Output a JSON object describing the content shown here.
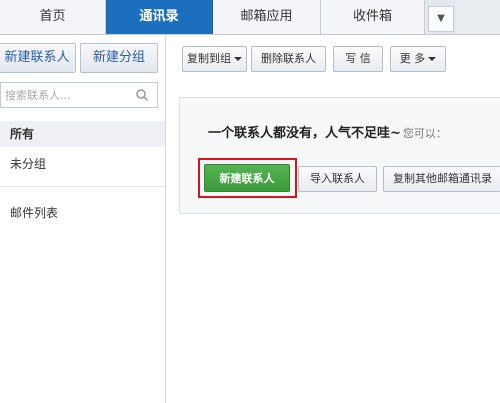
{
  "tabs": [
    {
      "label": "首页"
    },
    {
      "label": "通讯录"
    },
    {
      "label": "邮箱应用"
    },
    {
      "label": "收件箱"
    }
  ],
  "tabs_more_icon": "chevron-down-icon",
  "sidebar": {
    "new_contact_label": "新建联系人",
    "new_group_label": "新建分组",
    "search_placeholder": "搜索联系人...",
    "items": [
      {
        "label": "所有"
      },
      {
        "label": "未分组"
      },
      {
        "label": "邮件列表"
      }
    ]
  },
  "toolbar": {
    "copy_to_group_label": "复制到组",
    "delete_contact_label": "删除联系人",
    "write_label": "写 信",
    "more_label": "更 多"
  },
  "empty_state": {
    "message": "一个联系人都没有，人气不足哇~",
    "hint": "您可以：",
    "new_contact_label": "新建联系人",
    "import_label": "导入联系人",
    "copy_other_label": "复制其他邮箱通讯录"
  },
  "colors": {
    "active_tab": "#1c6fbd",
    "primary_button": "#46a745",
    "highlight_box": "#d8141a"
  }
}
